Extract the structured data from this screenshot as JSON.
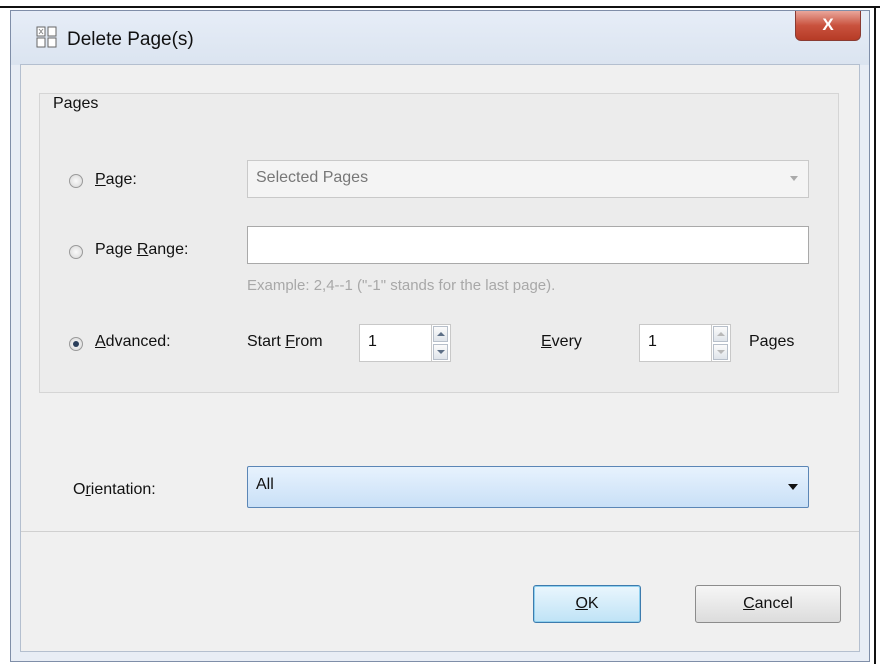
{
  "window": {
    "title": "Delete Page(s)",
    "close_label": "X"
  },
  "pages_group": {
    "label": "Pages",
    "page": {
      "label_prefix": "",
      "label_mnemonic": "P",
      "label_rest": "age:",
      "selected": false,
      "dropdown_value": "Selected Pages"
    },
    "page_range": {
      "label_prefix": "Page ",
      "label_mnemonic": "R",
      "label_rest": "ange:",
      "selected": false,
      "value": "",
      "hint": "Example: 2,4--1 (\"-1\" stands for the last page)."
    },
    "advanced": {
      "label_prefix": "",
      "label_mnemonic": "A",
      "label_rest": "dvanced:",
      "selected": true,
      "start_from_prefix": "Start ",
      "start_from_mnemonic": "F",
      "start_from_rest": "rom",
      "start_from_value": "1",
      "every_prefix": "",
      "every_mnemonic": "E",
      "every_rest": "very",
      "every_value": "1",
      "pages_label": "Pages"
    }
  },
  "orientation": {
    "label_prefix": "O",
    "label_mnemonic": "r",
    "label_rest": "ientation:",
    "value": "All"
  },
  "buttons": {
    "ok_mnemonic": "O",
    "ok_rest": "K",
    "cancel_mnemonic": "C",
    "cancel_rest": "ancel"
  },
  "colors": {
    "dialog_bg": "#f0f0f0",
    "title_bg": "#dbe4f0",
    "close_red": "#c9523e",
    "accent_blue": "#5b86b6"
  }
}
